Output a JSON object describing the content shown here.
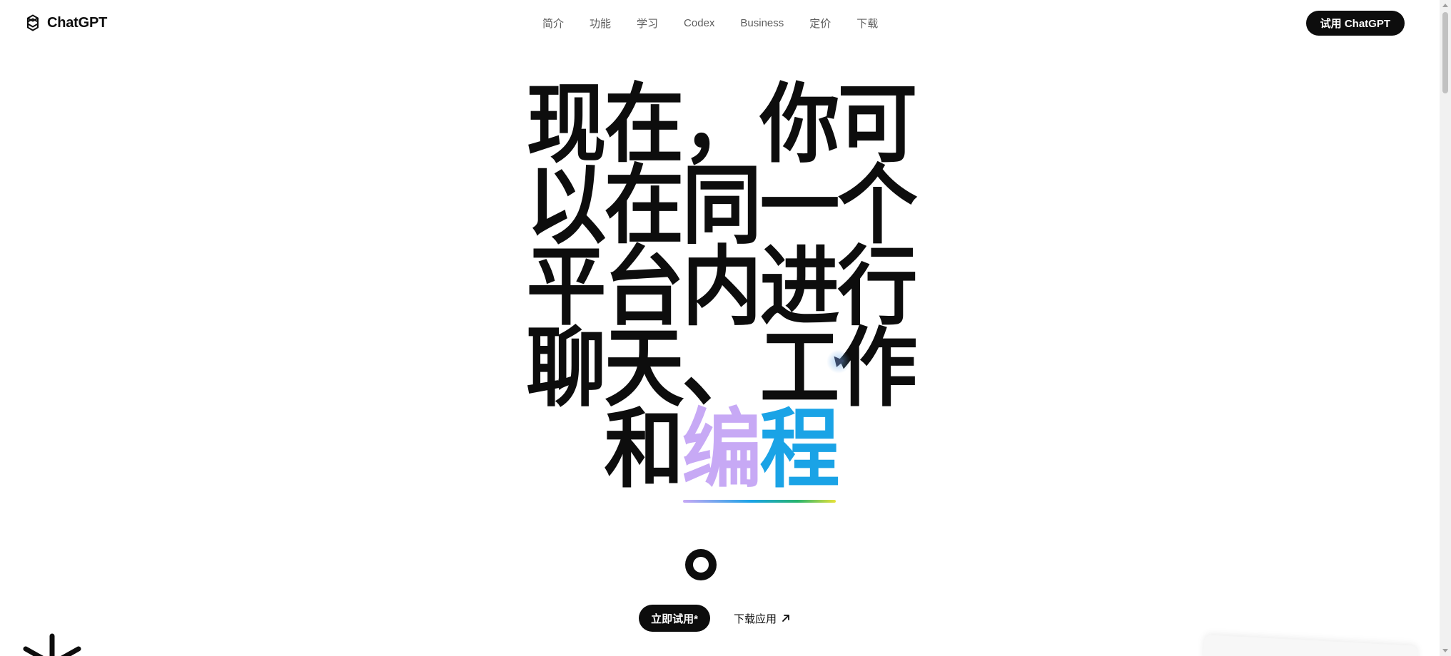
{
  "header": {
    "logo_text": "ChatGPT",
    "nav": [
      "简介",
      "功能",
      "学习",
      "Codex",
      "Business",
      "定价",
      "下载"
    ],
    "cta": "试用 ChatGPT"
  },
  "hero": {
    "lines": [
      [
        {
          "t": "现在，你可",
          "c": "dark"
        }
      ],
      [
        {
          "t": "以在同一个",
          "c": "dark"
        }
      ],
      [
        {
          "t": "平台内进行",
          "c": "dark"
        }
      ],
      [
        {
          "t": "聊天、工作",
          "c": "dark"
        }
      ],
      [
        {
          "t": "和",
          "c": "dark"
        },
        {
          "t": "编",
          "c": "purple"
        },
        {
          "t": "程",
          "c": "blue"
        }
      ]
    ]
  },
  "actions": {
    "primary": "立即试用*",
    "secondary": "下载应用"
  },
  "colors": {
    "text": "#0d0d0d",
    "accent_purple": "#c7a9f5",
    "accent_blue": "#1aa3e6"
  }
}
